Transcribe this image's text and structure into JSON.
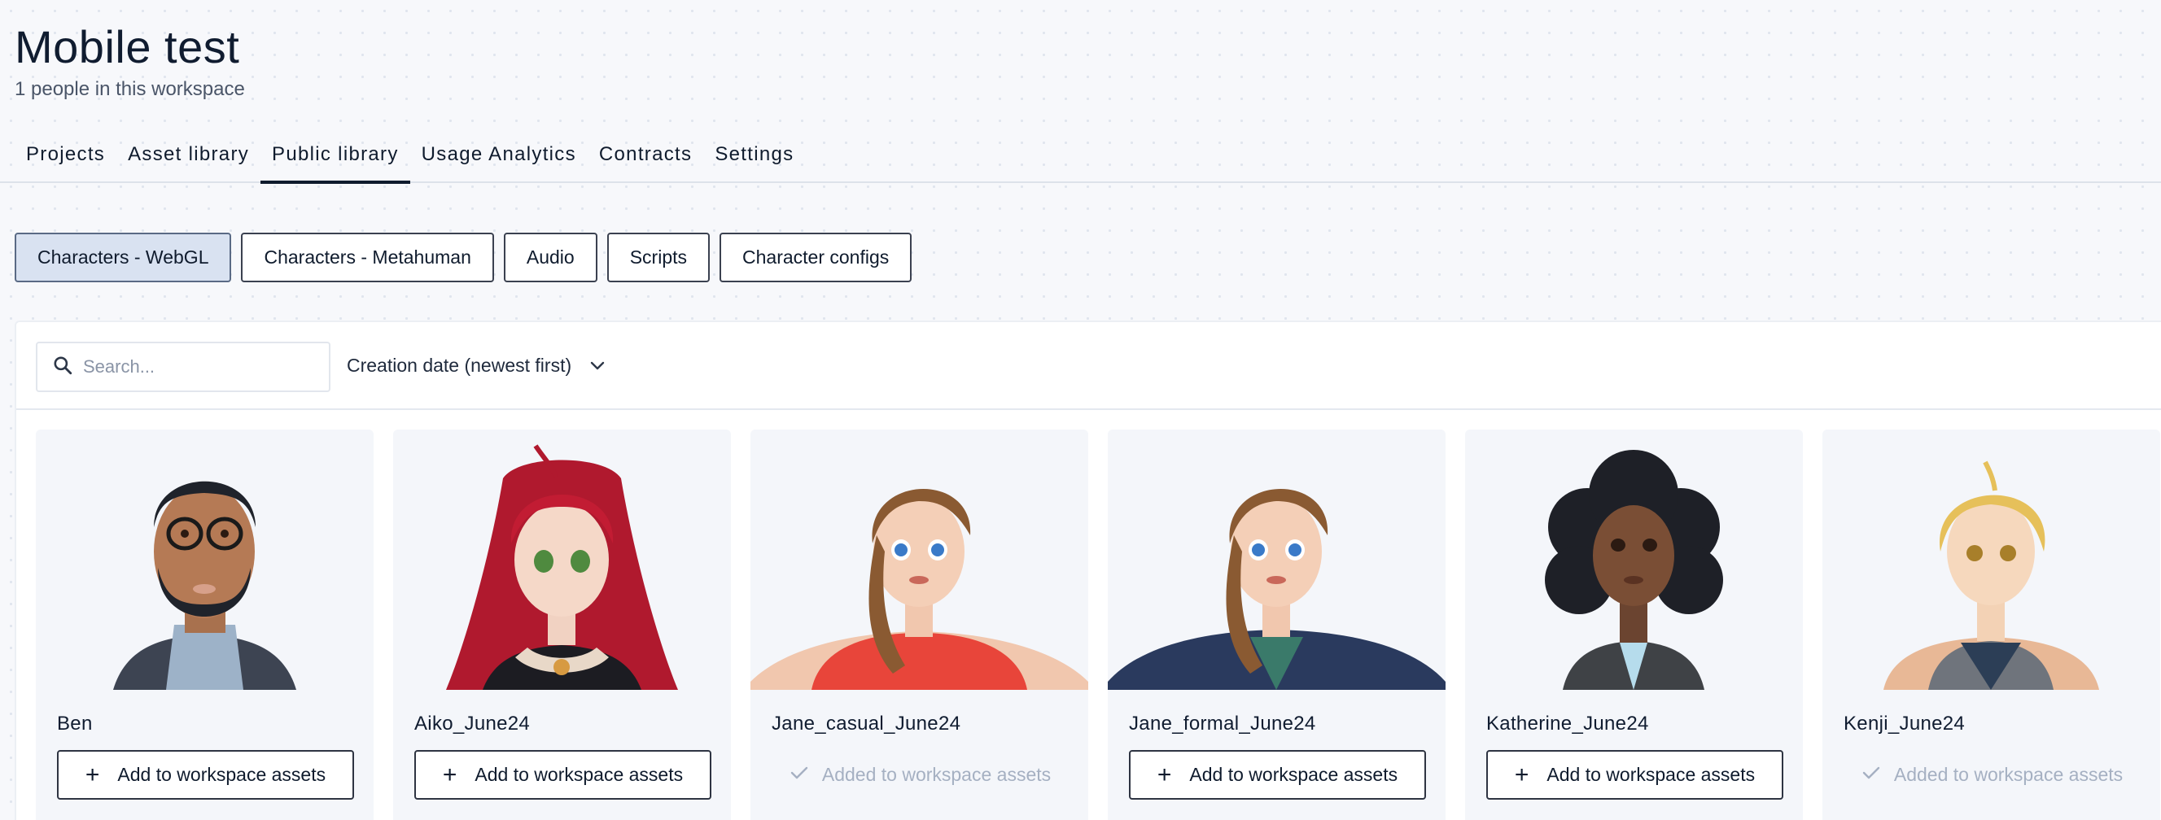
{
  "header": {
    "title": "Mobile test",
    "subtitle": "1 people in this workspace"
  },
  "nav": {
    "tabs": [
      {
        "label": "Projects"
      },
      {
        "label": "Asset library"
      },
      {
        "label": "Public library"
      },
      {
        "label": "Usage Analytics"
      },
      {
        "label": "Contracts"
      },
      {
        "label": "Settings"
      }
    ],
    "active": "Public library"
  },
  "filters": [
    {
      "label": "Characters - WebGL",
      "active": true
    },
    {
      "label": "Characters - Metahuman",
      "active": false
    },
    {
      "label": "Audio",
      "active": false
    },
    {
      "label": "Scripts",
      "active": false
    },
    {
      "label": "Character configs",
      "active": false
    }
  ],
  "toolbar": {
    "search_placeholder": "Search...",
    "search_value": "",
    "sort_label": "Creation date (newest first)"
  },
  "cards": [
    {
      "name": "Ben",
      "action": "Add to workspace assets",
      "added": false
    },
    {
      "name": "Aiko_June24",
      "action": "Add to workspace assets",
      "added": false
    },
    {
      "name": "Jane_casual_June24",
      "action": "Added to workspace assets",
      "added": true
    },
    {
      "name": "Jane_formal_June24",
      "action": "Add to workspace assets",
      "added": false
    },
    {
      "name": "Katherine_June24",
      "action": "Add to workspace assets",
      "added": false
    },
    {
      "name": "Kenji_June24",
      "action": "Added to workspace assets",
      "added": true
    }
  ],
  "colors": {
    "background": "#f7f8fb",
    "active_filter": "#d9e2f1",
    "text_primary": "#0f1b2d",
    "added_text": "#a5b0c2"
  }
}
